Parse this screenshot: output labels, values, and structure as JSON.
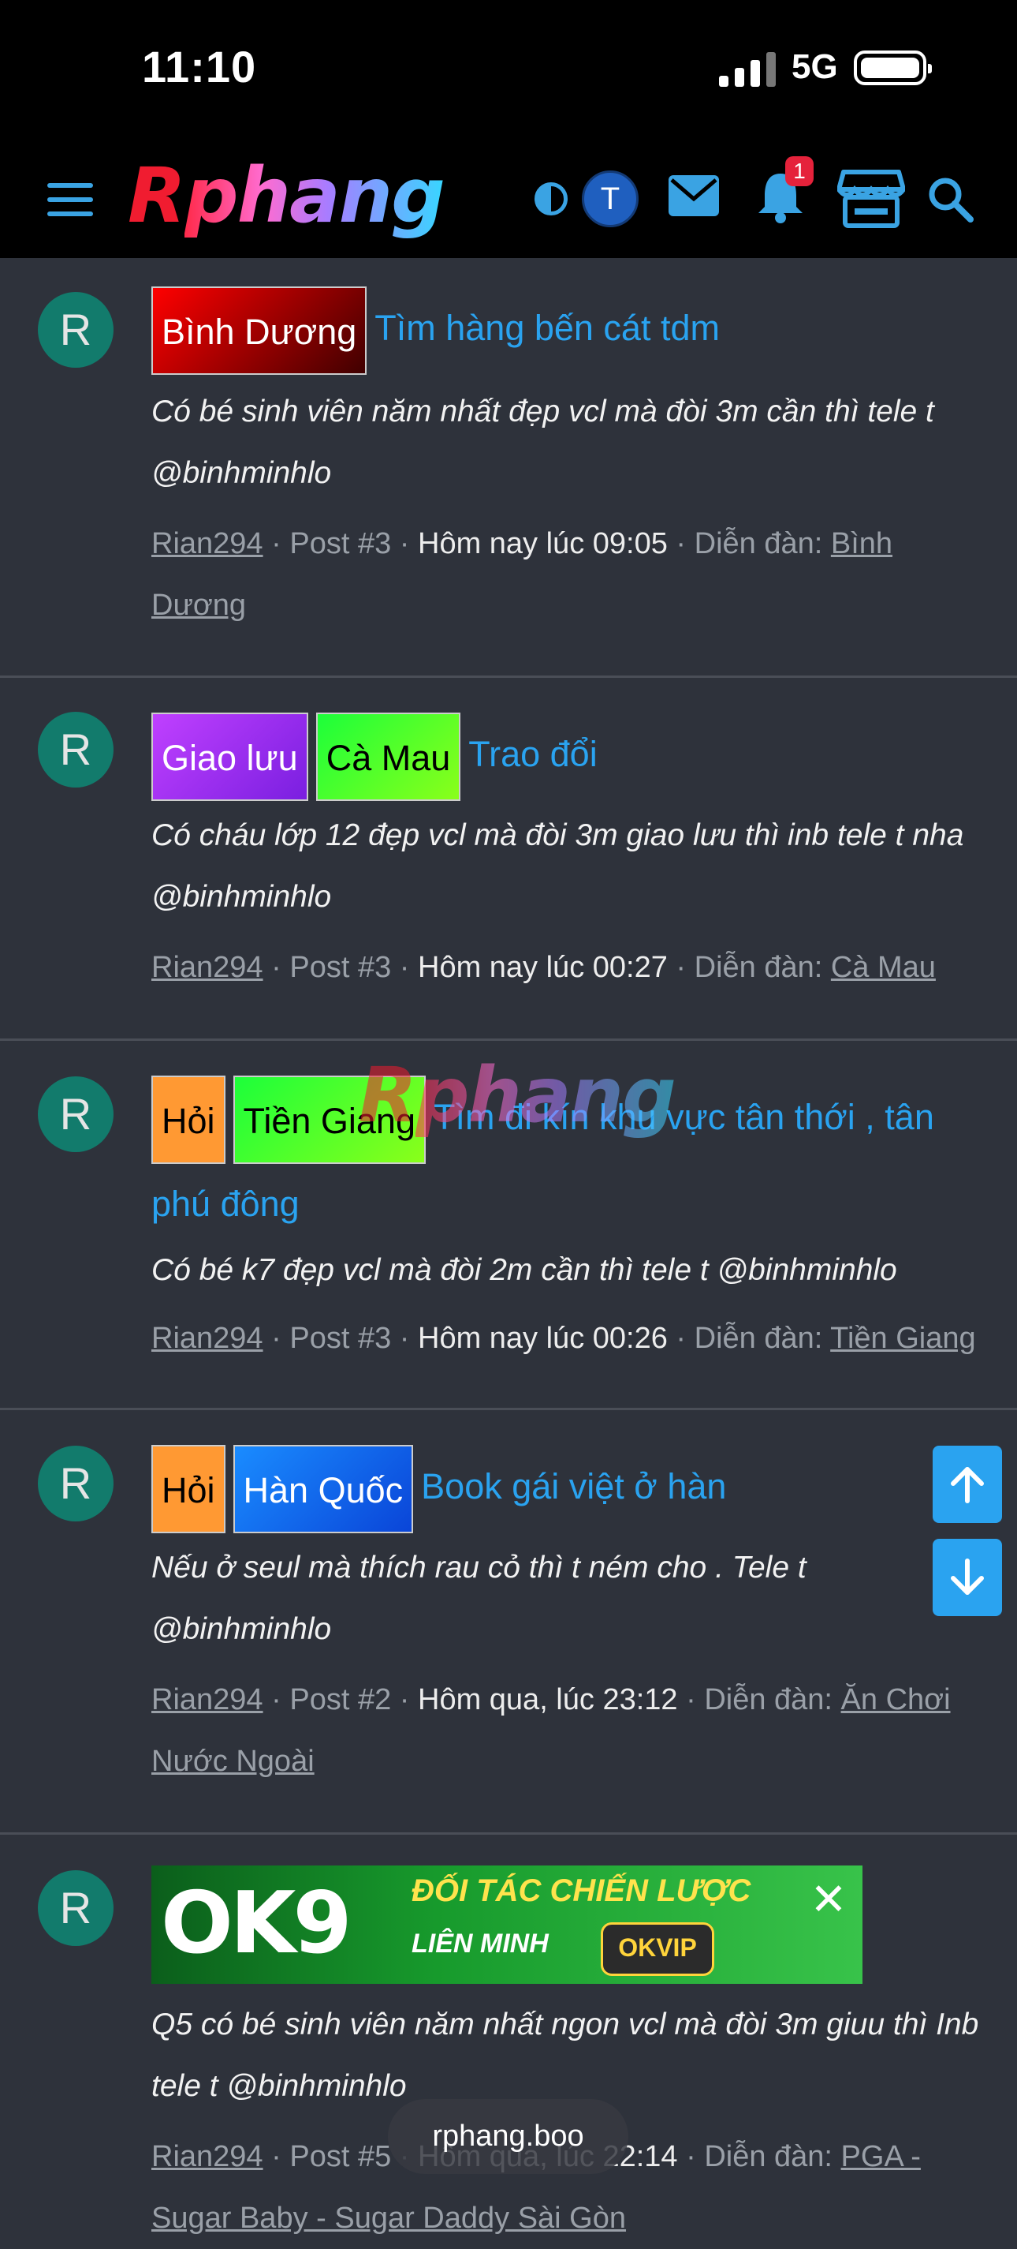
{
  "status_bar": {
    "time": "11:10",
    "network": "5G"
  },
  "header": {
    "logo": "Rphang",
    "avatar_letter": "T",
    "notification_count": "1"
  },
  "posts": [
    {
      "avatar": "R",
      "tags": [
        {
          "label": "Bình Dương"
        }
      ],
      "title": "Tìm hàng bến cát tdm",
      "snippet": "Có bé sinh viên năm nhất đẹp vcl mà đòi 3m cần thì tele t @binhminhlo",
      "author": "Rian294",
      "post_no": "Post #3",
      "time": "Hôm nay lúc 09:05",
      "forum_label": "Diễn đàn:",
      "forum": "Bình Dương"
    },
    {
      "avatar": "R",
      "tags": [
        {
          "label": "Giao lưu"
        },
        {
          "label": "Cà Mau"
        }
      ],
      "title": "Trao đổi",
      "snippet": "Có cháu lớp 12 đẹp vcl mà đòi 3m giao lưu thì inb tele t nha @binhminhlo",
      "author": "Rian294",
      "post_no": "Post #3",
      "time": "Hôm nay lúc 00:27",
      "forum_label": "Diễn đàn:",
      "forum": "Cà Mau"
    },
    {
      "avatar": "R",
      "tags": [
        {
          "label": "Hỏi"
        },
        {
          "label": "Tiền Giang"
        }
      ],
      "title": "Tìm đi kín khu vực tân thới , tân phú đông",
      "snippet": "Có bé k7 đẹp vcl mà đòi 2m cần thì tele t @binhminhlo",
      "author": "Rian294",
      "post_no": "Post #3",
      "time": "Hôm nay lúc 00:26",
      "forum_label": "Diễn đàn:",
      "forum": "Tiền Giang"
    },
    {
      "avatar": "R",
      "tags": [
        {
          "label": "Hỏi"
        },
        {
          "label": "Hàn Quốc"
        }
      ],
      "title": "Book gái việt ở hàn",
      "snippet": "Nếu ở seul mà thích rau cỏ thì t ném cho . Tele t @binhminhlo",
      "author": "Rian294",
      "post_no": "Post #2",
      "time": "Hôm qua, lúc 23:12",
      "forum_label": "Diễn đàn:",
      "forum": "Ăn Chơi Nước Ngoài"
    },
    {
      "avatar": "R",
      "snippet": "Q5 có bé sinh viên năm nhất ngon vcl mà đòi 3m giuu thì Inb tele t @binhminhlo",
      "author": "Rian294",
      "post_no": "Post #5",
      "time": "Hôm qua, lúc 22:14",
      "forum_label": "Diễn đàn:",
      "forum": "PGA - Sugar Baby - Sugar Daddy Sài Gòn"
    }
  ],
  "ad": {
    "brand": "OK9",
    "line1": "ĐỐI TÁC CHIẾN LƯỢC",
    "line2": "LIÊN MINH",
    "partner": "OKVIP"
  },
  "url_bar": {
    "domain": "rphang.boo"
  },
  "colors": {
    "accent": "#2aa3f0",
    "background": "#2e323b",
    "avatar_bg": "#127b6c"
  }
}
